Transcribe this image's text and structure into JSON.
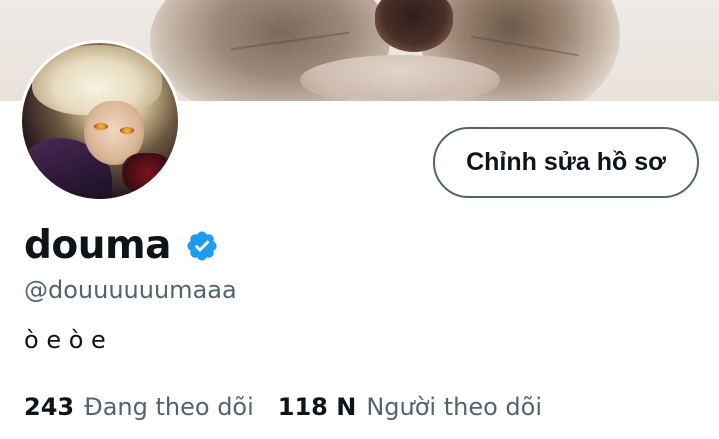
{
  "profile": {
    "display_name": "douma",
    "handle": "@douuuuuumaaa",
    "bio": "ò e ò e",
    "verified": true,
    "verified_color": "#1d9bf0",
    "edit_button_label": "Chỉnh sửa hồ sơ"
  },
  "stats": {
    "following_count": "243",
    "following_label": "Đang theo dõi",
    "followers_count": "118 N",
    "followers_label": "Người theo dõi"
  },
  "icons": {
    "verified": "verified-badge-icon"
  }
}
